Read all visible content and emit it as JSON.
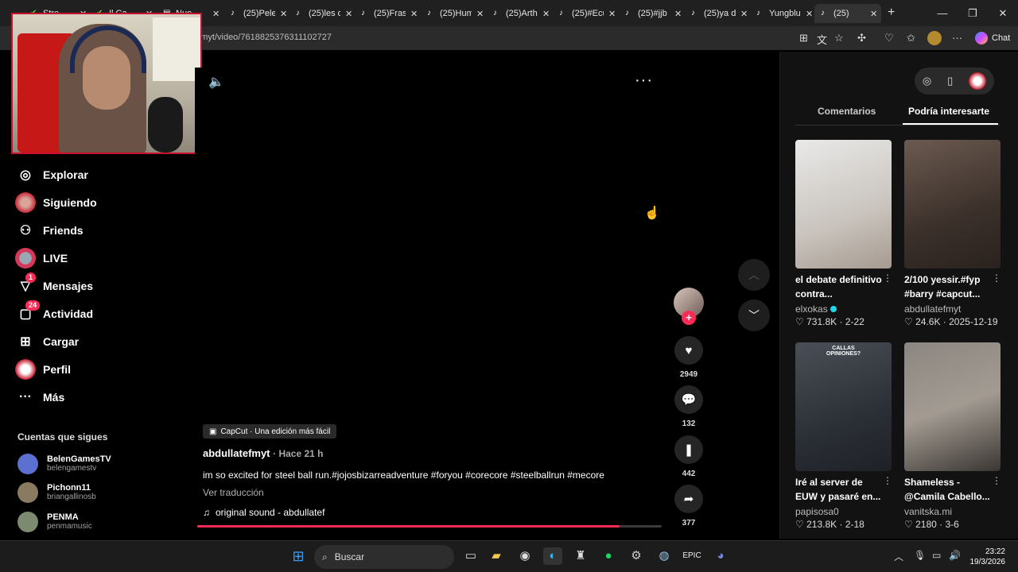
{
  "browser": {
    "tabs": [
      {
        "icon": "streamlabs-icon",
        "title": "Stre"
      },
      {
        "icon": "streamlabs-icon",
        "title": "Il Ca"
      },
      {
        "icon": "news-icon",
        "title": "Nue"
      },
      {
        "icon": "tiktok-icon",
        "title": "(25)Pelea"
      },
      {
        "icon": "tiktok-icon",
        "title": "(25)les d"
      },
      {
        "icon": "tiktok-icon",
        "title": "(25)Frase"
      },
      {
        "icon": "tiktok-icon",
        "title": "(25)Hum"
      },
      {
        "icon": "tiktok-icon",
        "title": "(25)Arth"
      },
      {
        "icon": "tiktok-icon",
        "title": "(25)#Ecu"
      },
      {
        "icon": "tiktok-icon",
        "title": "(25)#jjb"
      },
      {
        "icon": "tiktok-icon",
        "title": "(25)ya d"
      },
      {
        "icon": "tiktok-icon",
        "title": "Yungblu"
      },
      {
        "icon": "tiktok-icon",
        "title": "(25)"
      }
    ],
    "url": "tefmyt/video/7618825376311102727",
    "chat_label": "Chat"
  },
  "sidebar": {
    "items": [
      {
        "label": "Explorar",
        "icon": "compass-icon"
      },
      {
        "label": "Siguiendo",
        "icon": "following-avatar-icon"
      },
      {
        "label": "Friends",
        "icon": "friends-icon"
      },
      {
        "label": "LIVE",
        "icon": "live-icon"
      },
      {
        "label": "Mensajes",
        "icon": "message-icon",
        "badge": "1"
      },
      {
        "label": "Actividad",
        "icon": "activity-icon",
        "badge": "24"
      },
      {
        "label": "Cargar",
        "icon": "upload-icon"
      },
      {
        "label": "Perfil",
        "icon": "profile-icon"
      },
      {
        "label": "Más",
        "icon": "more-icon"
      }
    ],
    "following_title": "Cuentas que sigues",
    "accounts": [
      {
        "name": "BelenGamesTV",
        "handle": "belengamestv",
        "color": "#5d6fd0"
      },
      {
        "name": "Pichonn11",
        "handle": "briangallinosb",
        "color": "#8a7a60"
      },
      {
        "name": "PENMA",
        "handle": "penmamusic",
        "color": "#7c8a70"
      }
    ]
  },
  "video": {
    "capcut_label": "CapCut · Una edición más fácil",
    "author": "abdullatefmyt",
    "time": "· Hace 21 h",
    "caption": "im so excited for steel ball run.#jojosbizarreadventure #foryou #corecore #steelballrun #mecore",
    "translate": "Ver traducción",
    "sound": "original sound - abdullatef",
    "progress": 0.91,
    "likes": "2949",
    "comments": "132",
    "saves": "442",
    "shares": "377"
  },
  "rightpanel": {
    "tabs": [
      "Comentarios",
      "Podría interesarte"
    ],
    "cards": [
      {
        "title": "el debate definitivo contra...",
        "author": "elxokas",
        "verified": true,
        "likes": "731.8K",
        "date": "2-22",
        "bg": "linear-gradient(160deg,#e9e9e9,#c9c4bd 60%,#a69a90)"
      },
      {
        "title": "2/100 yessir.#fyp #barry #capcut...",
        "author": "abdullatefmyt",
        "verified": false,
        "likes": "24.6K",
        "date": "2025-12-19",
        "bg": "linear-gradient(160deg,#6b5a50,#3b302a 60%,#2a221e)"
      },
      {
        "title": "Iré al server de EUW y pasaré en...",
        "author": "papisosa0",
        "verified": false,
        "likes": "213.8K",
        "date": "2-18",
        "bg": "linear-gradient(160deg,#4a4f57,#2b2f36 60%,#1e2126)",
        "overlay": "CALLAS\nOPINIONES?"
      },
      {
        "title": "Shameless - @Camila Cabello...",
        "author": "vanitska.mi",
        "verified": false,
        "likes": "2180",
        "date": "3-6",
        "bg": "linear-gradient(160deg,#8b8680,#a39b92 50%,#3a3632)"
      }
    ]
  },
  "taskbar": {
    "search_label": "Buscar",
    "time": "23:22",
    "date": "19/3/2026"
  }
}
